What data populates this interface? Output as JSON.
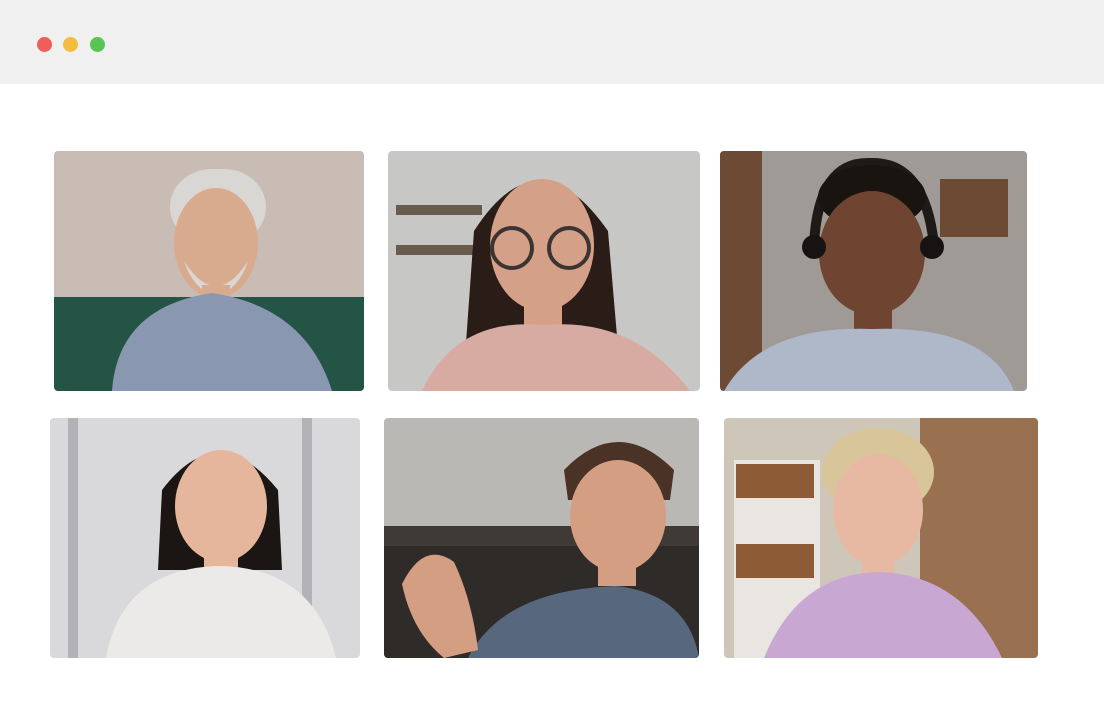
{
  "window": {
    "controls": [
      {
        "name": "close",
        "color": "#ec5f5b"
      },
      {
        "name": "minimize",
        "color": "#f4bd3f"
      },
      {
        "name": "maximize",
        "color": "#57c553"
      }
    ]
  },
  "call": {
    "participants": [
      {
        "icon": "participant-video",
        "palette": {
          "background": "#c9bcb4",
          "accent": "#245446",
          "skin": "#d8aa8e",
          "hair": "#d9d7d4",
          "shirt": "#8a97b0"
        }
      },
      {
        "icon": "participant-video",
        "palette": {
          "background": "#c7c7c5",
          "accent": "#6a5c4c",
          "skin": "#d5a088",
          "hair": "#2a1d17",
          "shirt": "#d8aba2"
        }
      },
      {
        "icon": "participant-video",
        "palette": {
          "background": "#9f9a96",
          "accent": "#6c4a33",
          "skin": "#6f4431",
          "hair": "#1a1410",
          "shirt": "#aeb8c8"
        }
      },
      {
        "icon": "participant-video",
        "palette": {
          "background": "#d9d9db",
          "accent": "#b3b3b7",
          "skin": "#e5b69b",
          "hair": "#1b1514",
          "shirt": "#ebeae8"
        }
      },
      {
        "icon": "participant-video",
        "palette": {
          "background": "#b9b8b5",
          "accent": "#3f3a36",
          "skin": "#d49e83",
          "hair": "#4a3326",
          "shirt": "#56677e"
        }
      },
      {
        "icon": "participant-video",
        "palette": {
          "background": "#cfc6ba",
          "accent": "#8d5c37",
          "skin": "#e7b9a2",
          "hair": "#d9c59a",
          "shirt": "#c8a8d2"
        }
      }
    ]
  }
}
